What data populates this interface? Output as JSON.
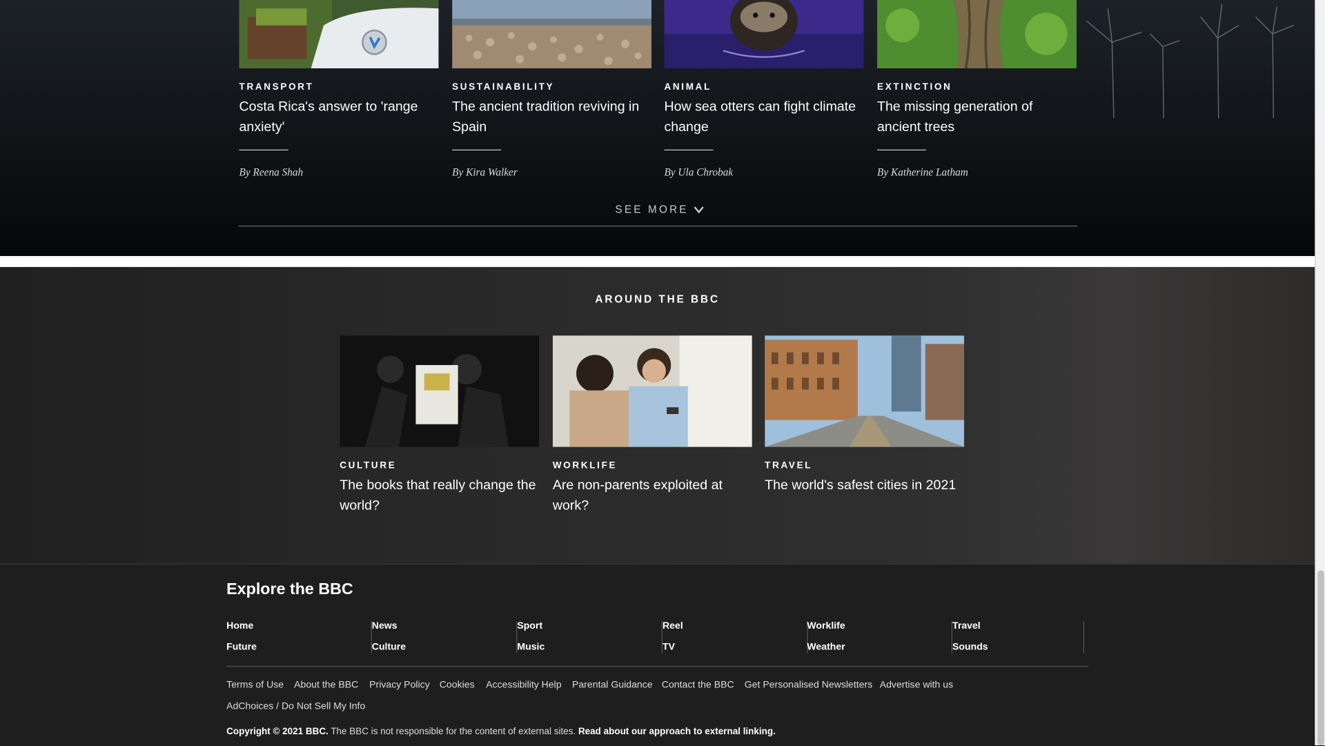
{
  "top_cards": [
    {
      "tag": "TRANSPORT",
      "headline": "Costa Rica's answer to 'range anxiety'",
      "byline": "By Reena Shah",
      "image": "electric-car-charging-image"
    },
    {
      "tag": "SUSTAINABILITY",
      "headline": "The ancient tradition reviving in Spain",
      "byline": "By Kira Walker",
      "image": "sheep-flock-image"
    },
    {
      "tag": "ANIMAL",
      "headline": "How sea otters can fight climate change",
      "byline": "By Ula Chrobak",
      "image": "sea-otter-image"
    },
    {
      "tag": "EXTINCTION",
      "headline": "The missing generation of ancient trees",
      "byline": "By Katherine Latham",
      "image": "ancient-tree-image"
    }
  ],
  "see_more_label": "SEE MORE",
  "around": {
    "title": "AROUND THE BBC",
    "cards": [
      {
        "tag": "CULTURE",
        "headline": "The books that really change the world?",
        "image": "stage-performance-image"
      },
      {
        "tag": "WORKLIFE",
        "headline": "Are non-parents exploited at work?",
        "image": "office-workers-image"
      },
      {
        "tag": "TRAVEL",
        "headline": "The world's safest cities in 2021",
        "image": "city-street-image"
      }
    ]
  },
  "footer": {
    "title": "Explore the BBC",
    "nav": [
      [
        "Home",
        "Future"
      ],
      [
        "News",
        "Culture"
      ],
      [
        "Sport",
        "Music"
      ],
      [
        "Reel",
        "TV"
      ],
      [
        "Worklife",
        "Weather"
      ],
      [
        "Travel",
        "Sounds"
      ]
    ],
    "links_row1": [
      "Terms of Use",
      "About the BBC",
      "Privacy Policy",
      "Cookies",
      "Accessibility Help",
      "Parental Guidance",
      "Contact the BBC",
      "Get Personalised Newsletters",
      "Advertise with us"
    ],
    "links_row2": [
      "AdChoices / Do Not Sell My Info"
    ],
    "copyright_bold": "Copyright © 2021 BBC.",
    "copyright_text": " The BBC is not responsible for the content of external sites. ",
    "copyright_link": "Read about our approach to external linking."
  }
}
